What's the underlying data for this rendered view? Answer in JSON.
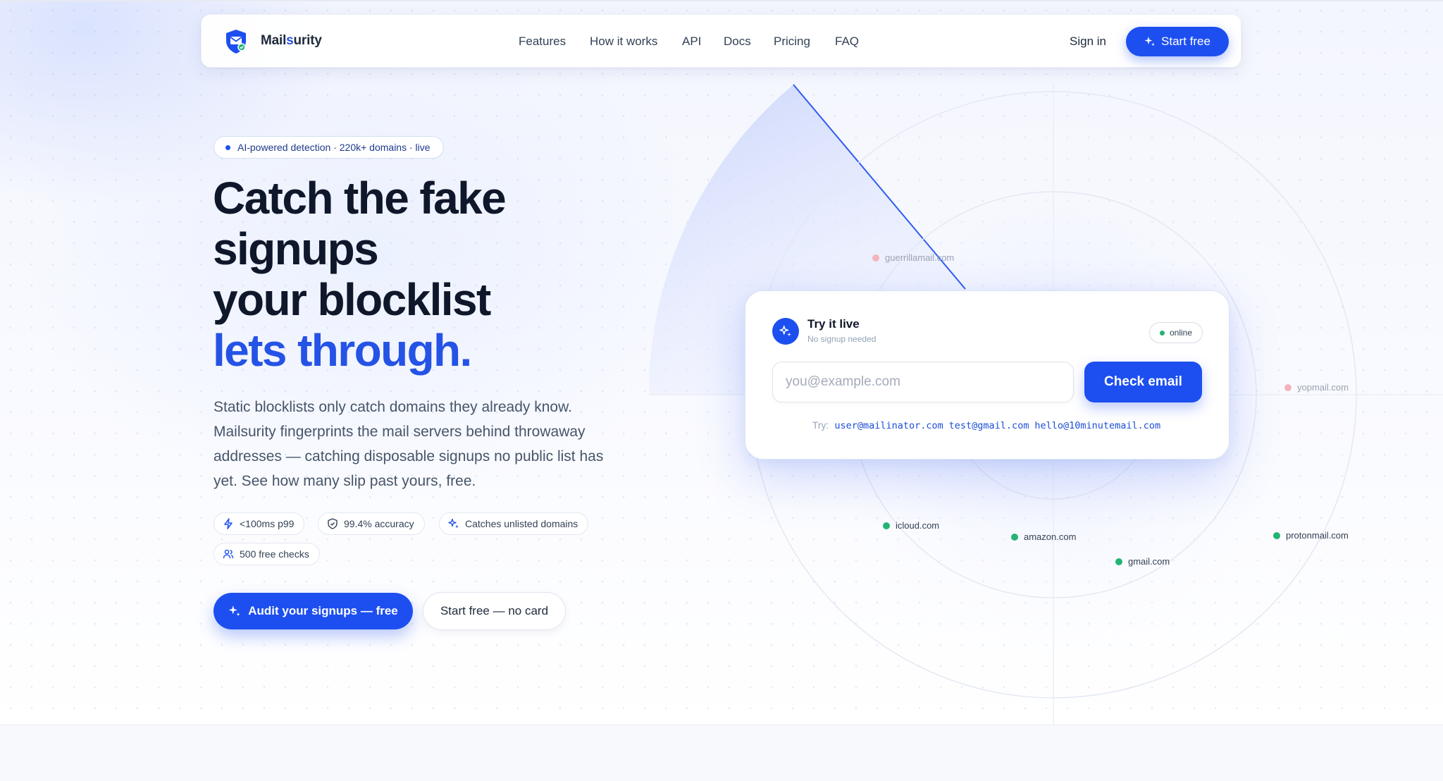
{
  "nav": {
    "brand_prefix": "Mail",
    "brand_accent": "s",
    "brand_suffix": "urity",
    "links": [
      "Features",
      "How it works",
      "API",
      "Docs",
      "Pricing",
      "FAQ"
    ],
    "sign_in": "Sign in",
    "cta": "Start free"
  },
  "hero": {
    "badge": "AI-powered detection · 220k+ domains · live",
    "title_lines": [
      "Catch the fake",
      "signups",
      "your blocklist"
    ],
    "title_highlight": "lets through.",
    "description": "Static blocklists only catch domains they already know. Mailsurity fingerprints the mail servers behind throwaway addresses — catching disposable signups no public list has yet. See how many slip past yours, free.",
    "pills": [
      {
        "icon": "bolt-icon",
        "label": "<100ms p99"
      },
      {
        "icon": "shield-check-icon",
        "label": "99.4% accuracy"
      },
      {
        "icon": "sparkle-icon",
        "label": "Catches unlisted domains"
      },
      {
        "icon": "users-icon",
        "label": "500 free checks"
      }
    ],
    "primary_cta": "Audit your signups — free",
    "secondary_cta": "Start free — no card"
  },
  "radar": {
    "disposable_domains": [
      "guerrillamail.com",
      "yopmail.com"
    ],
    "trusted_domains": [
      "icloud.com",
      "amazon.com",
      "gmail.com",
      "protonmail.com"
    ]
  },
  "try_card": {
    "title": "Try it live",
    "subtitle": "No signup needed",
    "status": "online",
    "input_placeholder": "you@example.com",
    "input_value": "",
    "button": "Check email",
    "examples_label": "Try:",
    "examples": [
      "user@mailinator.com",
      "test@gmail.com",
      "hello@10minutemail.com"
    ]
  },
  "colors": {
    "brand": "#1d4ff0",
    "heading": "#0f172a",
    "text": "#475569",
    "trusted": "#22b573",
    "disposable": "#f5b3bb"
  }
}
